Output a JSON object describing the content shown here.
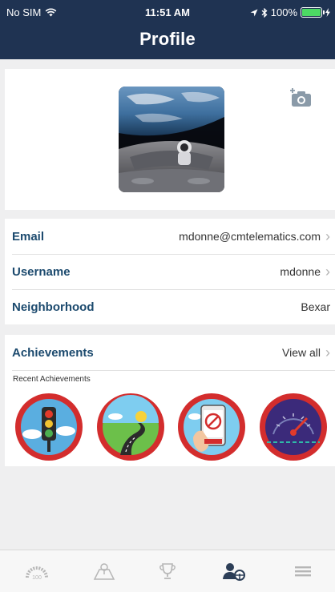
{
  "status_bar": {
    "carrier": "No SIM",
    "time": "11:51 AM",
    "battery_percent": "100%"
  },
  "header": {
    "title": "Profile"
  },
  "profile_photo": {
    "image": "avatar"
  },
  "info": {
    "email": {
      "label": "Email",
      "value": "mdonne@cmtelematics.com"
    },
    "username": {
      "label": "Username",
      "value": "mdonne"
    },
    "neighborhood": {
      "label": "Neighborhood",
      "value": "Bexar"
    }
  },
  "achievements": {
    "title": "Achievements",
    "view_all": "View all",
    "recent_label": "Recent Achievements",
    "badges": [
      "traffic-light-badge",
      "road-badge",
      "phone-badge",
      "speedometer-badge"
    ]
  },
  "tabbar": {
    "score_value": "100",
    "items": [
      "score-icon",
      "map-icon",
      "trophy-icon",
      "profile-icon",
      "menu-icon"
    ],
    "active": "profile-icon"
  },
  "colors": {
    "header_bg": "#1f3352",
    "label_blue": "#1c4a6e",
    "badge_ring": "#d32d2d",
    "battery_green": "#4cd964"
  }
}
